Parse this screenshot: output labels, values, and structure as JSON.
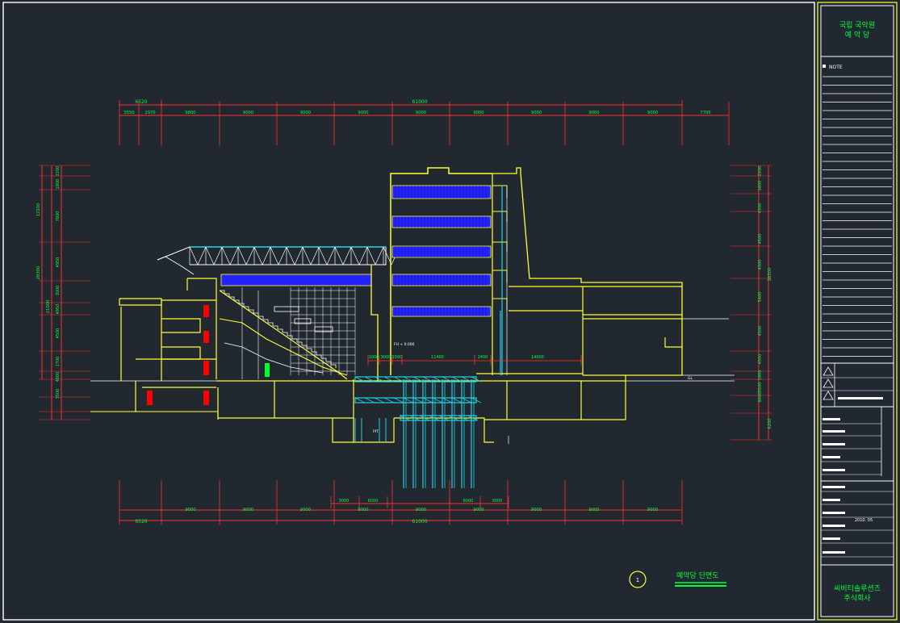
{
  "title_block": {
    "project_line1": "국립 국악원",
    "project_line2": "예 악 당",
    "note_label": "NOTE",
    "drawing_no": "2010. 05",
    "company_line1": "씨비티솔루션즈",
    "company_line2": "주식회사"
  },
  "drawing": {
    "caption_number": "1",
    "caption_title": "예악당 단면도",
    "pit_label": "PIT",
    "level_label": "FH + 0.000",
    "gl_label": "GL",
    "colors": {
      "background": "#212830",
      "frame": "#ffffff",
      "dimension": "#ff3030",
      "dimension_text": "#00ff3c",
      "outline": "#ffff33",
      "seats": "#2323ff",
      "stage_machinery": "#22d3e6",
      "accent_red": "#ff0000",
      "accent_green": "#00ff2a"
    }
  },
  "dimensions": {
    "top_total_left": "6520",
    "top_total": "61000",
    "top_row": [
      "3550",
      "2970",
      "9800",
      "9000",
      "9000",
      "9000",
      "9000",
      "9000",
      "9000",
      "9000",
      "9000",
      "7700"
    ],
    "bottom_total_left": "6520",
    "bottom_total": "61000",
    "bottom_row": [
      "9000",
      "9000",
      "9000",
      "9000",
      "9000",
      "9000",
      "9000",
      "9000",
      "9000"
    ],
    "bottom_mid": [
      "3000",
      "6000",
      "6000",
      "3000"
    ],
    "left_outer": [
      "12200",
      "21000",
      "28300"
    ],
    "left_inner": [
      "2200",
      "1800",
      "7800",
      "4950",
      "3000",
      "4950",
      "4500",
      "1700",
      "4800",
      "3500"
    ],
    "right_outer": [
      "28300",
      "6200"
    ],
    "right_inner": [
      "2200",
      "1600",
      "4300",
      "4500",
      "4300",
      "5400",
      "4500",
      "4500",
      "1800",
      "3500",
      "6000"
    ],
    "stage_row": [
      "1000",
      "3000",
      "1500",
      "11400",
      "2400",
      "14000"
    ]
  }
}
